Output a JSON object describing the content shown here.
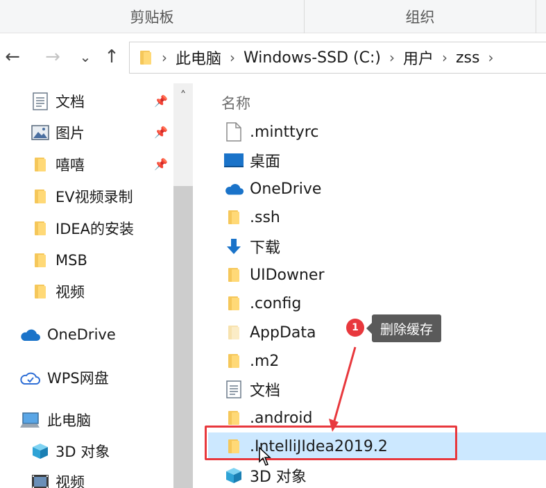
{
  "ribbon": {
    "groups": [
      {
        "label": "剪贴板"
      },
      {
        "label": "组织"
      }
    ]
  },
  "nav_buttons": {
    "back": "←",
    "forward": "→",
    "recent": "⌄",
    "up": "↑"
  },
  "address": {
    "crumbs": [
      "此电脑",
      "Windows-SSD (C:)",
      "用户",
      "zss"
    ],
    "separator": "›"
  },
  "navpane": {
    "items": [
      {
        "label": "文档",
        "icon": "document-icon",
        "pinned": true
      },
      {
        "label": "图片",
        "icon": "picture-icon",
        "pinned": true
      },
      {
        "label": "嘻嘻",
        "icon": "folder-icon",
        "pinned": true
      },
      {
        "label": "EV视频录制",
        "icon": "folder-icon",
        "pinned": false
      },
      {
        "label": "IDEA的安装",
        "icon": "folder-icon",
        "pinned": false
      },
      {
        "label": "MSB",
        "icon": "folder-icon",
        "pinned": false
      },
      {
        "label": "视频",
        "icon": "folder-icon",
        "pinned": false
      },
      {
        "label": "OneDrive",
        "icon": "cloud-icon",
        "pinned": false
      },
      {
        "label": "WPS网盘",
        "icon": "wps-cloud-icon",
        "pinned": false
      },
      {
        "label": "此电脑",
        "icon": "computer-icon",
        "pinned": false
      },
      {
        "label": "3D 对象",
        "icon": "cube-icon",
        "pinned": false
      },
      {
        "label": "视频",
        "icon": "video-icon",
        "pinned": false
      }
    ],
    "pin_glyph": "📌",
    "scroll_up": "˄"
  },
  "filelist": {
    "column_name": "名称",
    "rows": [
      {
        "name": ".minttyrc",
        "icon": "file-icon"
      },
      {
        "name": "桌面",
        "icon": "desktop-icon"
      },
      {
        "name": "OneDrive",
        "icon": "cloud-icon"
      },
      {
        "name": ".ssh",
        "icon": "folder-icon"
      },
      {
        "name": "下载",
        "icon": "download-icon"
      },
      {
        "name": "UIDowner",
        "icon": "folder-icon"
      },
      {
        "name": ".config",
        "icon": "folder-icon"
      },
      {
        "name": "AppData",
        "icon": "hidden-folder-icon"
      },
      {
        "name": ".m2",
        "icon": "folder-icon"
      },
      {
        "name": "文档",
        "icon": "document-icon"
      },
      {
        "name": ".android",
        "icon": "folder-icon"
      },
      {
        "name": ".IntelliJIdea2019.2",
        "icon": "folder-icon",
        "selected": true
      },
      {
        "name": "3D 对象",
        "icon": "cube-icon"
      }
    ]
  },
  "annotation": {
    "badge": "1",
    "tooltip": "删除缓存",
    "color": "#e8383d"
  },
  "colors": {
    "selection": "#cce8ff",
    "folder": "#f5c75a",
    "highlight": "#e8383d"
  }
}
